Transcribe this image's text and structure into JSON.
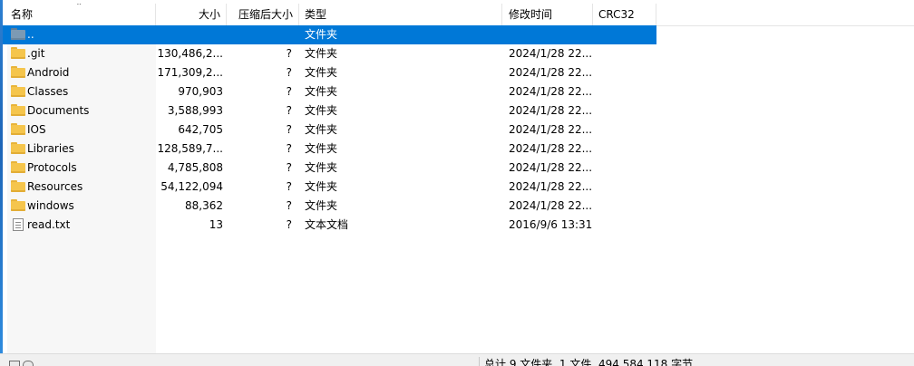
{
  "columns": {
    "name": "名称",
    "size": "大小",
    "packed": "压缩后大小",
    "type": "类型",
    "modified": "修改时间",
    "crc": "CRC32"
  },
  "rows": [
    {
      "name": "..",
      "size": "",
      "packed": "",
      "type": "文件夹",
      "modified": "",
      "crc": "",
      "icon": "folder-up-icon"
    },
    {
      "name": ".git",
      "size": "130,486,2...",
      "packed": "?",
      "type": "文件夹",
      "modified": "2024/1/28 22...",
      "crc": "",
      "icon": "folder-icon"
    },
    {
      "name": "Android",
      "size": "171,309,2...",
      "packed": "?",
      "type": "文件夹",
      "modified": "2024/1/28 22...",
      "crc": "",
      "icon": "folder-icon"
    },
    {
      "name": "Classes",
      "size": "970,903",
      "packed": "?",
      "type": "文件夹",
      "modified": "2024/1/28 22...",
      "crc": "",
      "icon": "folder-icon"
    },
    {
      "name": "Documents",
      "size": "3,588,993",
      "packed": "?",
      "type": "文件夹",
      "modified": "2024/1/28 22...",
      "crc": "",
      "icon": "folder-icon"
    },
    {
      "name": "IOS",
      "size": "642,705",
      "packed": "?",
      "type": "文件夹",
      "modified": "2024/1/28 22...",
      "crc": "",
      "icon": "folder-icon"
    },
    {
      "name": "Libraries",
      "size": "128,589,7...",
      "packed": "?",
      "type": "文件夹",
      "modified": "2024/1/28 22...",
      "crc": "",
      "icon": "folder-icon"
    },
    {
      "name": "Protocols",
      "size": "4,785,808",
      "packed": "?",
      "type": "文件夹",
      "modified": "2024/1/28 22...",
      "crc": "",
      "icon": "folder-icon"
    },
    {
      "name": "Resources",
      "size": "54,122,094",
      "packed": "?",
      "type": "文件夹",
      "modified": "2024/1/28 22...",
      "crc": "",
      "icon": "folder-icon"
    },
    {
      "name": "windows",
      "size": "88,362",
      "packed": "?",
      "type": "文件夹",
      "modified": "2024/1/28 22...",
      "crc": "",
      "icon": "folder-icon"
    },
    {
      "name": "read.txt",
      "size": "13",
      "packed": "?",
      "type": "文本文档",
      "modified": "2016/9/6 13:31",
      "crc": "",
      "icon": "text-file-icon"
    }
  ],
  "status": {
    "summary": "总计 9 文件夹, 1 文件, 494,584,118 字节"
  },
  "colors": {
    "selection": "#0078d7",
    "folder": "#f5c54c"
  }
}
